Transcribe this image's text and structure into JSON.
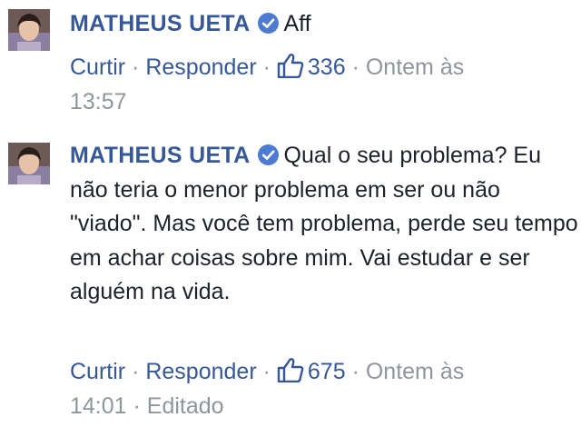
{
  "comments": [
    {
      "author": "MATHEUS UETA",
      "text": "Aff",
      "actions": {
        "like": "Curtir",
        "reply": "Responder"
      },
      "separator": "·",
      "like_count": "336",
      "timestamp_line1": "Ontem às",
      "timestamp_line2": "13:57",
      "edited": ""
    },
    {
      "author": "MATHEUS UETA",
      "text": "Qual o seu problema? Eu não teria o menor problema em ser ou não \"viado\". Mas você tem problema, perde seu tempo em achar coisas sobre mim. Vai estudar e ser alguém na vida.",
      "actions": {
        "like": "Curtir",
        "reply": "Responder"
      },
      "separator": "·",
      "like_count": "675",
      "timestamp_line1": "Ontem às",
      "timestamp_line2": "14:01",
      "edited": "Editado"
    }
  ],
  "colors": {
    "author": "#365899",
    "action_link": "#365899",
    "meta_gray": "#90949c",
    "body_text": "#1d2129",
    "verified_badge": "#4d7bd1"
  },
  "icons": {
    "verified": "verified-badge-icon",
    "like": "thumbs-up-icon",
    "avatar": "user-avatar"
  }
}
